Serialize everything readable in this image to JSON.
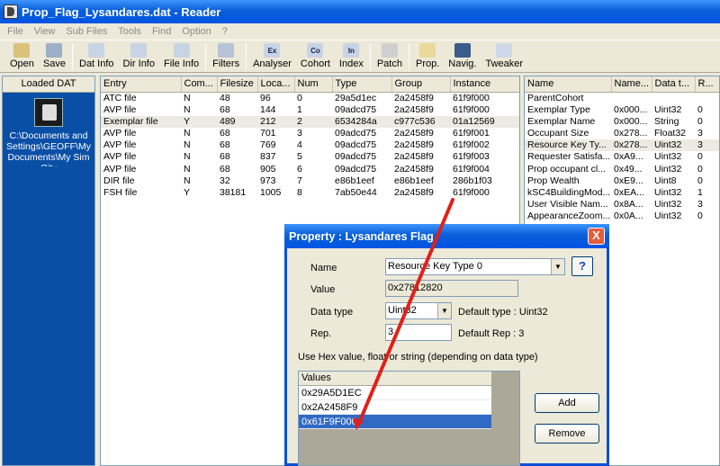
{
  "window": {
    "title": "Prop_Flag_Lysandares.dat - Reader"
  },
  "menu": [
    "File",
    "View",
    "Sub Files",
    "Tools",
    "Find",
    "Option",
    "?"
  ],
  "toolbar": [
    {
      "label": "Open",
      "icon": "open-icon"
    },
    {
      "label": "Save",
      "icon": "save-icon"
    },
    {
      "label": "Dat Info",
      "icon": "dat-info-icon"
    },
    {
      "label": "Dir Info",
      "icon": "dir-info-icon"
    },
    {
      "label": "File Info",
      "icon": "file-info-icon"
    },
    {
      "label": "Filters",
      "icon": "filters-icon"
    },
    {
      "label": "Analyser",
      "icon": "analyser-icon",
      "glyph": "Ex"
    },
    {
      "label": "Cohort",
      "icon": "cohort-icon",
      "glyph": "Co"
    },
    {
      "label": "Index",
      "icon": "index-icon",
      "glyph": "In"
    },
    {
      "label": "Patch",
      "icon": "patch-icon"
    },
    {
      "label": "Prop.",
      "icon": "prop-icon"
    },
    {
      "label": "Navig.",
      "icon": "navig-icon"
    },
    {
      "label": "Tweaker",
      "icon": "tweaker-icon"
    }
  ],
  "left_panel": {
    "header": "Loaded DAT",
    "path": "C:\\Documents and Settings\\GEOFF\\My Documents\\My SimCity"
  },
  "entries": {
    "columns": [
      "Entry",
      "Com...",
      "Filesize",
      "Loca...",
      "Num",
      "Type",
      "Group",
      "Instance"
    ],
    "rows": [
      [
        "ATC file",
        "N",
        "48",
        "96",
        "0",
        "29a5d1ec",
        "2a2458f9",
        "61f9f000"
      ],
      [
        "AVP file",
        "N",
        "68",
        "144",
        "1",
        "09adcd75",
        "2a2458f9",
        "61f9f000"
      ],
      [
        "Exemplar file",
        "Y",
        "489",
        "212",
        "2",
        "6534284a",
        "c977c536",
        "01a12569"
      ],
      [
        "AVP file",
        "N",
        "68",
        "701",
        "3",
        "09adcd75",
        "2a2458f9",
        "61f9f001"
      ],
      [
        "AVP file",
        "N",
        "68",
        "769",
        "4",
        "09adcd75",
        "2a2458f9",
        "61f9f002"
      ],
      [
        "AVP file",
        "N",
        "68",
        "837",
        "5",
        "09adcd75",
        "2a2458f9",
        "61f9f003"
      ],
      [
        "AVP file",
        "N",
        "68",
        "905",
        "6",
        "09adcd75",
        "2a2458f9",
        "61f9f004"
      ],
      [
        "DIR file",
        "N",
        "32",
        "973",
        "7",
        "e86b1eef",
        "e86b1eef",
        "286b1f03"
      ],
      [
        "FSH file",
        "Y",
        "38181",
        "1005",
        "8",
        "7ab50e44",
        "2a2458f9",
        "61f9f000"
      ]
    ],
    "selected_index": 2
  },
  "properties": {
    "columns": [
      "Name",
      "Name...",
      "Data t...",
      "R..."
    ],
    "rows": [
      [
        "ParentCohort",
        "",
        "",
        ""
      ],
      [
        "Exemplar Type",
        "0x000...",
        "Uint32",
        "0"
      ],
      [
        "Exemplar Name",
        "0x000...",
        "String",
        "0"
      ],
      [
        "Occupant Size",
        "0x278...",
        "Float32",
        "3"
      ],
      [
        "Resource Key Ty...",
        "0x278...",
        "Uint32",
        "3"
      ],
      [
        "Requester Satisfa...",
        "0xA9...",
        "Uint32",
        "0"
      ],
      [
        "Prop occupant cl...",
        "0x49...",
        "Uint32",
        "0"
      ],
      [
        "Prop Wealth",
        "0xE9...",
        "Uint8",
        "0"
      ],
      [
        "kSC4BuildingMod...",
        "0xEA...",
        "Uint32",
        "1"
      ],
      [
        "User Visible Nam...",
        "0x8A...",
        "Uint32",
        "3"
      ],
      [
        "AppearanceZoom...",
        "0x0A...",
        "Uint32",
        "0"
      ]
    ],
    "selected_index": 4
  },
  "dialog": {
    "title": "Property : Lysandares Flag",
    "name_label": "Name",
    "name_value": "Resource Key Type 0",
    "help_label": "?",
    "value_label": "Value",
    "value_value": "0x27812820",
    "datatype_label": "Data type",
    "datatype_value": "Uint32",
    "default_type": "Default type : Uint32",
    "rep_label": "Rep.",
    "rep_value": "3",
    "default_rep": "Default Rep :  3",
    "hint": "Use Hex value, float or string (depending on data type)",
    "values_header": "Values",
    "values": [
      "0x29A5D1EC",
      "0x2A2458F9",
      "0x61F9F000"
    ],
    "selected_value_index": 2,
    "add_label": "Add",
    "remove_label": "Remove",
    "close_label": "X"
  },
  "colors": {
    "titlebar": "#0054e3",
    "selection": "#316ac5",
    "annotation_arrow": "#e0201a",
    "left_panel": "#0a4fa6"
  }
}
